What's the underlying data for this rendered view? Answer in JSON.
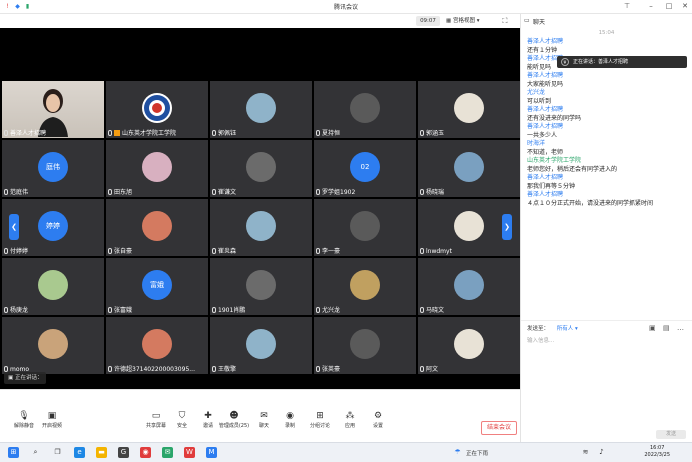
{
  "window": {
    "title": "腾讯会议",
    "buttons": [
      "pin-icon",
      "minimize-icon",
      "maximize-icon",
      "close-icon"
    ]
  },
  "topbar": {
    "time": "09:07",
    "grid_view_label": "宫格视图"
  },
  "tiles": [
    {
      "name": "善泽人才招聘",
      "type": "video"
    },
    {
      "name": "山东英才学院工学院",
      "type": "logo"
    },
    {
      "name": "郭佩钰",
      "type": "photo"
    },
    {
      "name": "夏持恒",
      "type": "photo"
    },
    {
      "name": "郭涵玉",
      "type": "photo"
    },
    {
      "name": "范庭伟",
      "type": "initials",
      "initials": "庭伟"
    },
    {
      "name": "田东旭",
      "type": "photo"
    },
    {
      "name": "崔谦文",
      "type": "photo"
    },
    {
      "name": "罗学姐1902",
      "type": "initials",
      "initials": "02"
    },
    {
      "name": "杨晓瑞",
      "type": "photo"
    },
    {
      "name": "付婷婷",
      "type": "initials",
      "initials": "婷婷"
    },
    {
      "name": "张自豪",
      "type": "photo"
    },
    {
      "name": "崔炎森",
      "type": "photo"
    },
    {
      "name": "李一豪",
      "type": "photo"
    },
    {
      "name": "lnwdmyt",
      "type": "photo"
    },
    {
      "name": "杨庚龙",
      "type": "photo"
    },
    {
      "name": "张富娥",
      "type": "initials",
      "initials": "富娥"
    },
    {
      "name": "1901肖鹏",
      "type": "photo"
    },
    {
      "name": "尤兴龙",
      "type": "photo"
    },
    {
      "name": "马晓文",
      "type": "photo"
    },
    {
      "name": "momo",
      "type": "photo"
    },
    {
      "name": "许德超371402200003095...",
      "type": "photo"
    },
    {
      "name": "王敬擎",
      "type": "photo"
    },
    {
      "name": "张英豪",
      "type": "photo"
    },
    {
      "name": "阿文",
      "type": "photo"
    }
  ],
  "speaking": "正在讲话：",
  "toolbar": {
    "items": [
      {
        "label": "解除静音",
        "icon": "mic-off-icon"
      },
      {
        "label": "开启视频",
        "icon": "camera-off-icon"
      },
      {
        "label": "共享屏幕",
        "icon": "share-screen-icon"
      },
      {
        "label": "安全",
        "icon": "shield-icon"
      },
      {
        "label": "邀请",
        "icon": "invite-icon"
      },
      {
        "label": "管理成员(25)",
        "icon": "members-icon"
      },
      {
        "label": "聊天",
        "icon": "chat-icon"
      },
      {
        "label": "录制",
        "icon": "record-icon"
      },
      {
        "label": "分组讨论",
        "icon": "breakout-icon"
      },
      {
        "label": "应用",
        "icon": "apps-icon"
      },
      {
        "label": "设置",
        "icon": "settings-icon"
      }
    ],
    "leave_label": "结束会议"
  },
  "chat": {
    "title": "聊天",
    "timestamp": "15:04",
    "toast": "正在讲话：善泽人才招聘",
    "messages": [
      {
        "sender": "善泽人才招聘",
        "text": "还有１分钟"
      },
      {
        "sender": "善泽人才招聘",
        "text": ""
      },
      {
        "sender": "",
        "text": "能听见吗"
      },
      {
        "sender": "善泽人才招聘",
        "text": "大家能听见吗"
      },
      {
        "sender": "尤兴龙",
        "text": "可以听到"
      },
      {
        "sender": "善泽人才招聘",
        "text": "还有没进来的同学吗"
      },
      {
        "sender": "善泽人才招聘",
        "text": "一共多少人"
      },
      {
        "sender": "时海洋",
        "text": "不知道，老师"
      },
      {
        "sender": "山东英才学院工学院",
        "text": "老师您好，稍后还会有同学进入的",
        "green": true
      },
      {
        "sender": "善泽人才招聘",
        "text": "那我们再等５分钟"
      },
      {
        "sender": "善泽人才招聘",
        "text": "４点１０分正式开始，请没进来的同学抓紧时间"
      }
    ],
    "send_to_label": "发送至：",
    "send_to_value": "所有人",
    "input_placeholder": "输入信息...",
    "send_button": "发送"
  },
  "taskbar": {
    "weather": "正在下雨",
    "time": "16:07",
    "date": "2022/3/25"
  }
}
